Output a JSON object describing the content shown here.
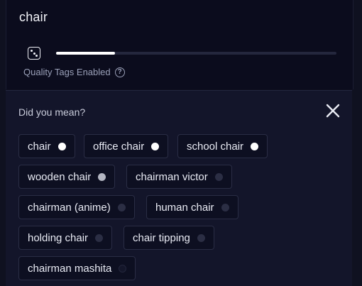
{
  "prompt": {
    "text": "chair"
  },
  "controls": {
    "dice_icon": "dice-icon",
    "strength_fraction": 0.21,
    "quality_label": "Quality Tags Enabled",
    "help_icon": "question-circle-icon",
    "help_glyph": "?"
  },
  "suggestions": {
    "title": "Did you mean?",
    "close_icon": "close-icon",
    "chips": [
      {
        "label": "chair",
        "level": 1
      },
      {
        "label": "office chair",
        "level": 1
      },
      {
        "label": "school chair",
        "level": 1
      },
      {
        "label": "wooden chair",
        "level": 2
      },
      {
        "label": "chairman victor",
        "level": 3
      },
      {
        "label": "chairman (anime)",
        "level": 3
      },
      {
        "label": "human chair",
        "level": 3
      },
      {
        "label": "holding chair",
        "level": 3
      },
      {
        "label": "chair tipping",
        "level": 3
      },
      {
        "label": "chairman mashita",
        "level": 4
      }
    ]
  },
  "colors": {
    "background": "#0f1120",
    "card": "#0b0c1d",
    "panel": "#13152a",
    "chip": "#0d0f21",
    "text": "#e9ebf4",
    "muted": "#9aa0b8"
  }
}
